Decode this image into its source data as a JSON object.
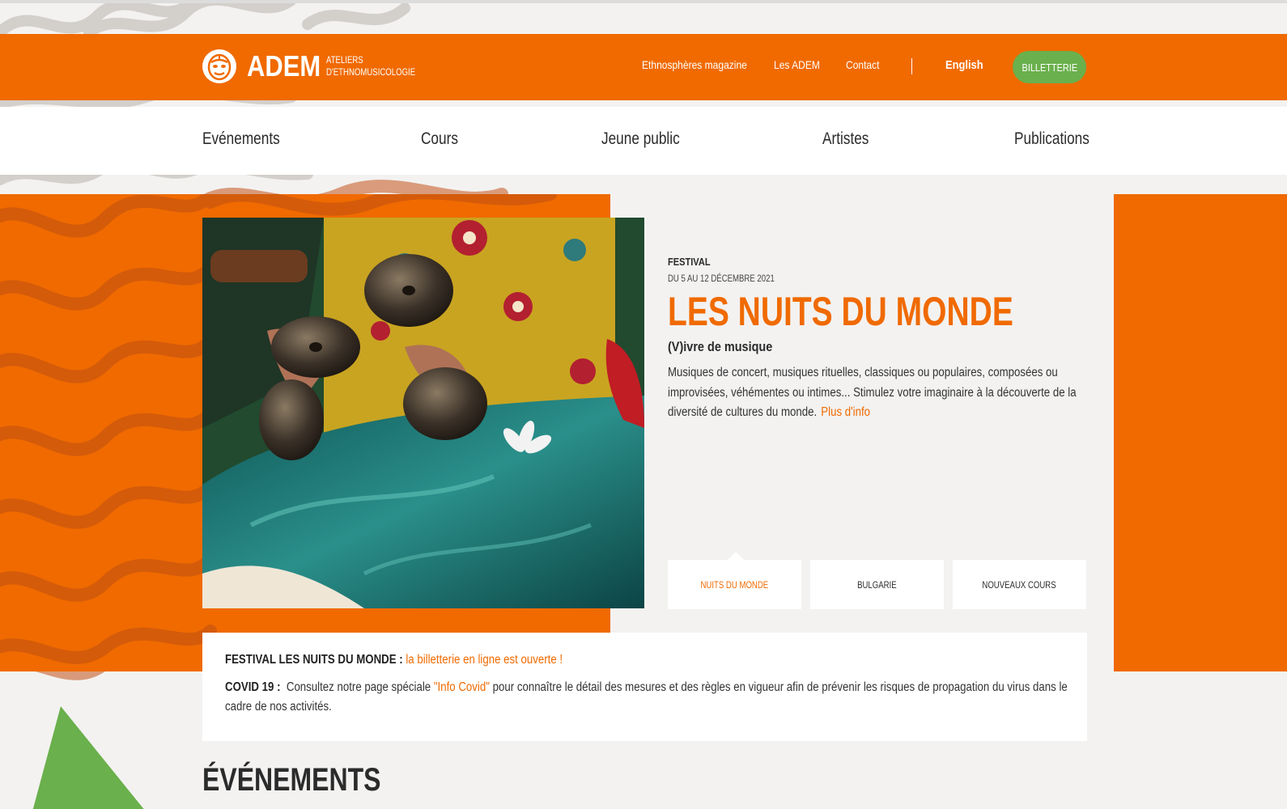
{
  "brand": {
    "wordmark": "ADEM",
    "subtitle_line1": "ATELIERS",
    "subtitle_line2": "D'ETHNOMUSICOLOGIE"
  },
  "topnav": {
    "magazine": "Ethnosphères magazine",
    "les_adem": "Les ADEM",
    "contact": "Contact",
    "language": "English",
    "tickets": "BILLETTERIE"
  },
  "mainnav": {
    "items": [
      "Evénements",
      "Cours",
      "Jeune public",
      "Artistes",
      "Publications"
    ]
  },
  "hero": {
    "eyebrow": "FESTIVAL",
    "dates": "DU 5 AU 12 DÉCEMBRE 2021",
    "title": "LES NUITS DU MONDE",
    "subtitle": "(V)ivre de musique",
    "description": "Musiques de concert, musiques rituelles, classiques ou populaires, composées ou improvisées, véhémentes ou intimes... Stimulez votre imaginaire à la découverte de la diversité de cultures du monde.",
    "more_link": "Plus d'info"
  },
  "tabs": [
    "NUITS DU MONDE",
    "BULGARIE",
    "NOUVEAUX COURS"
  ],
  "notice": {
    "festival_label": "FESTIVAL LES NUITS DU MONDE :",
    "festival_link": "la billetterie en ligne est ouverte !",
    "covid_label": "COVID 19 :",
    "covid_text_before": "Consultez notre page spéciale",
    "covid_link": "\"Info Covid\"",
    "covid_text_after": "pour connaître le détail des mesures et des règles en vigueur afin de prévenir les risques de propagation du virus dans le cadre de nos activités."
  },
  "section": {
    "events_title": "ÉVÉNEMENTS"
  },
  "colors": {
    "orange": "#f06a00",
    "green": "#6ab04c",
    "background": "#f3f2f1"
  }
}
